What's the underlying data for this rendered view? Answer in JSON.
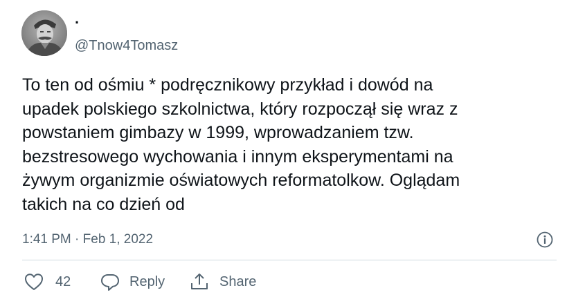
{
  "tweet": {
    "author": {
      "display_name": ".",
      "handle": "@Tnow4Tomasz"
    },
    "text": "To ten od ośmiu * podręcznikowy przykład i dowód na\nupadek polskiego szkolnictwa, który rozpoczął się wraz z\npowstaniem gimbazy w 1999, wprowadzaniem tzw.\nbezstresowego wychowania i innym eksperymentami na\nżywym organizmie oświatowych reformatolkow. Oglądam\ntakich na co dzień od",
    "timestamp": "1:41 PM · Feb 1, 2022",
    "actions": {
      "like_count": "42",
      "reply_label": "Reply",
      "share_label": "Share"
    }
  },
  "icons": {
    "avatar": "avatar-photo",
    "info": "info-icon",
    "like": "heart-icon",
    "reply": "reply-icon",
    "share": "share-icon"
  },
  "colors": {
    "text_primary": "#0f1419",
    "text_secondary": "#536471",
    "divider": "#cfd9de"
  }
}
